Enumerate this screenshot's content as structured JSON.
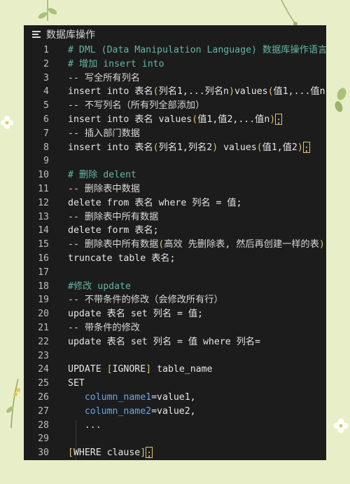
{
  "window": {
    "title": "数据库操作"
  },
  "lines": [
    {
      "n": "1",
      "parts": [
        [
          "comment",
          "# DML (Data Manipulation Language) 数据库操作语言"
        ]
      ]
    },
    {
      "n": "2",
      "parts": [
        [
          "comment",
          "# 增加 insert into"
        ]
      ]
    },
    {
      "n": "3",
      "parts": [
        [
          "dim",
          "-- 写全所有列名"
        ]
      ]
    },
    {
      "n": "4",
      "parts": [
        [
          "kw",
          "insert into 表名"
        ],
        [
          "paren",
          "("
        ],
        [
          "kw",
          "列名1,...列名n"
        ],
        [
          "paren",
          ")"
        ],
        [
          "kw",
          "values"
        ],
        [
          "paren",
          "("
        ],
        [
          "kw",
          "值1,...值n"
        ]
      ]
    },
    {
      "n": "5",
      "parts": [
        [
          "dim",
          "-- 不写列名（所有列全部添加）"
        ]
      ]
    },
    {
      "n": "6",
      "parts": [
        [
          "kw",
          "insert into 表名 values"
        ],
        [
          "paren",
          "("
        ],
        [
          "kw",
          "值1,值2,...值n"
        ],
        [
          "paren",
          ")"
        ],
        [
          "cursor",
          ";"
        ]
      ]
    },
    {
      "n": "7",
      "parts": [
        [
          "dim",
          "-- 插入部门数据"
        ]
      ]
    },
    {
      "n": "8",
      "parts": [
        [
          "kw",
          "insert into 表名"
        ],
        [
          "paren",
          "("
        ],
        [
          "kw",
          "列名1,列名2"
        ],
        [
          "paren",
          ")"
        ],
        [
          "kw",
          " values"
        ],
        [
          "paren",
          "("
        ],
        [
          "kw",
          "值1,值2"
        ],
        [
          "paren",
          ")"
        ],
        [
          "cursor",
          ";"
        ]
      ]
    },
    {
      "n": "9",
      "parts": []
    },
    {
      "n": "10",
      "parts": [
        [
          "comment",
          "# 删除 delent"
        ]
      ]
    },
    {
      "n": "11",
      "parts": [
        [
          "dim",
          "-- 删除表中数据"
        ]
      ]
    },
    {
      "n": "12",
      "parts": [
        [
          "kw",
          "delete from 表名 where 列名 = 值;"
        ]
      ]
    },
    {
      "n": "13",
      "parts": [
        [
          "dim",
          "-- 删除表中所有数据"
        ]
      ]
    },
    {
      "n": "14",
      "parts": [
        [
          "kw",
          "delete form 表名;"
        ]
      ]
    },
    {
      "n": "15",
      "parts": [
        [
          "dim",
          "-- 删除表中所有数据"
        ],
        [
          "paren",
          "("
        ],
        [
          "dim",
          "高效 先删除表, 然后再创建一样的表"
        ],
        [
          "paren",
          ")"
        ]
      ]
    },
    {
      "n": "16",
      "parts": [
        [
          "kw",
          "truncate table 表名;"
        ]
      ]
    },
    {
      "n": "17",
      "parts": []
    },
    {
      "n": "18",
      "parts": [
        [
          "comment",
          "#修改 update"
        ]
      ]
    },
    {
      "n": "19",
      "parts": [
        [
          "dim",
          "-- 不带条件的修改（会修改所有行）"
        ]
      ]
    },
    {
      "n": "20",
      "parts": [
        [
          "kw",
          "update 表名 set 列名 = 值;"
        ]
      ]
    },
    {
      "n": "21",
      "parts": [
        [
          "dim",
          "-- 带条件的修改"
        ]
      ]
    },
    {
      "n": "22",
      "parts": [
        [
          "kw",
          "update 表名 set 列名 = 值 where 列名="
        ]
      ]
    },
    {
      "n": "23",
      "parts": []
    },
    {
      "n": "24",
      "parts": [
        [
          "kw",
          "UPDATE "
        ],
        [
          "brkt",
          "["
        ],
        [
          "kw",
          "IGNORE"
        ],
        [
          "brkt",
          "]"
        ],
        [
          "kw",
          " table_name"
        ]
      ]
    },
    {
      "n": "25",
      "parts": [
        [
          "kw",
          "SET"
        ]
      ]
    },
    {
      "n": "26",
      "parts": [
        [
          "kw",
          "   "
        ],
        [
          "col",
          "column_name1"
        ],
        [
          "kw",
          "=value1,"
        ]
      ]
    },
    {
      "n": "27",
      "parts": [
        [
          "kw",
          "   "
        ],
        [
          "col",
          "column_name2"
        ],
        [
          "kw",
          "=value2,"
        ]
      ]
    },
    {
      "n": "28",
      "parts": [
        [
          "kw",
          "   ..."
        ]
      ]
    },
    {
      "n": "29",
      "parts": []
    },
    {
      "n": "30",
      "parts": [
        [
          "brkt",
          "["
        ],
        [
          "kw",
          "WHERE clause"
        ],
        [
          "brkt",
          "]"
        ],
        [
          "cursor",
          ";"
        ]
      ]
    }
  ]
}
